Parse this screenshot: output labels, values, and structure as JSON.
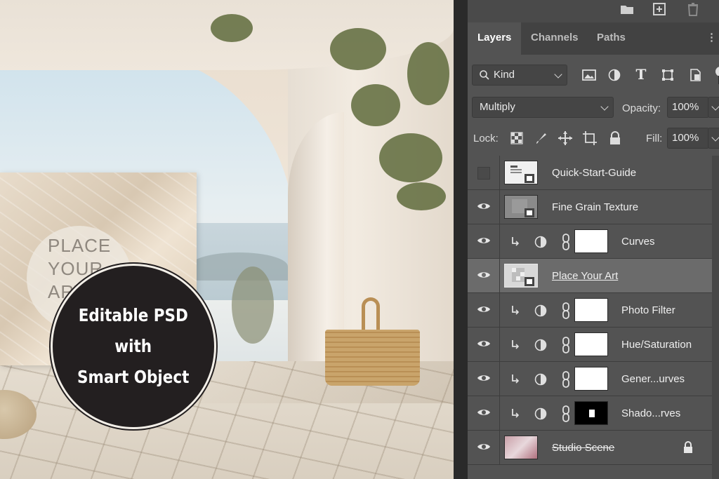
{
  "scene": {
    "art_placeholder": [
      "PLACE",
      "YOUR",
      "ART"
    ],
    "badge": [
      "Editable PSD",
      "with",
      "Smart Object"
    ]
  },
  "panel": {
    "tabs": [
      "Layers",
      "Channels",
      "Paths"
    ],
    "active_tab": "Layers",
    "filter_kind": "Kind",
    "blend_mode": "Multiply",
    "opacity_label": "Opacity:",
    "opacity_value": "100%",
    "lock_label": "Lock:",
    "fill_label": "Fill:",
    "fill_value": "100%",
    "layers": [
      {
        "name": "Quick-Start-Guide",
        "visible": false
      },
      {
        "name": "Fine Grain Texture",
        "visible": true
      },
      {
        "name": "Curves",
        "visible": true
      },
      {
        "name": "Place Your Art",
        "visible": true,
        "selected": true
      },
      {
        "name": "Photo Filter",
        "visible": true
      },
      {
        "name": "Hue/Saturation",
        "visible": true
      },
      {
        "name": "Gener...urves",
        "visible": true
      },
      {
        "name": "Shado...rves",
        "visible": true
      },
      {
        "name": "Studio Scene",
        "visible": true,
        "locked": true
      }
    ]
  },
  "colors": {
    "panel_bg": "#535353",
    "selected_row": "#6b6b6b",
    "badge_bg": "#231f20"
  }
}
